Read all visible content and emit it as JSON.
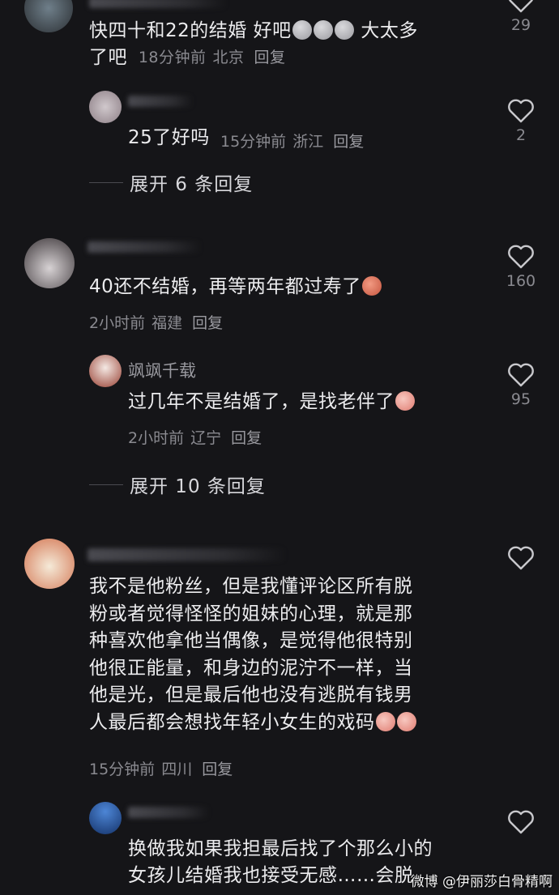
{
  "comments": [
    {
      "text_line1": "快四十和22的结婚 好吧",
      "text_line1_tail": " 大太多",
      "text_line2": "了吧",
      "time": "18分钟前",
      "location": "北京",
      "reply": "回复",
      "likes": "29"
    },
    {
      "text": "25了好吗",
      "time": "15分钟前",
      "location": "浙江",
      "reply": "回复",
      "likes": "2"
    },
    {
      "expand": "展开 6 条回复"
    },
    {
      "text": "40还不结婚，再等两年都过寿了",
      "time": "2小时前",
      "location": "福建",
      "reply": "回复",
      "likes": "160"
    },
    {
      "author": "飒飒千载",
      "text": "过几年不是结婚了，是找老伴了",
      "time": "2小时前",
      "location": "辽宁",
      "reply": "回复",
      "likes": "95"
    },
    {
      "expand": "展开 10 条回复"
    },
    {
      "lines": [
        "我不是他粉丝，但是我懂评论区所有脱",
        "粉或者觉得怪怪的姐妹的心理，就是那",
        "种喜欢他拿他当偶像，是觉得他很特别",
        "他很正能量，和身边的泥泞不一样，当",
        "他是光，但是最后他也没有逃脱有钱男",
        "人最后都会想找年轻小女生的戏码"
      ],
      "time": "15分钟前",
      "location": "四川",
      "reply": "回复",
      "likes": ""
    },
    {
      "lines": [
        "换做我如果我担最后找了个那么小的",
        "女孩儿结婚我也接受无感……会脱"
      ],
      "likes": ""
    }
  ],
  "watermark": "微博 @伊丽莎白骨精啊",
  "colors": {
    "background": "#151518",
    "text": "#ececee",
    "meta": "#8a8a90"
  },
  "icons": {
    "like": "heart-outline-icon",
    "emoji": "emoji-icon"
  }
}
